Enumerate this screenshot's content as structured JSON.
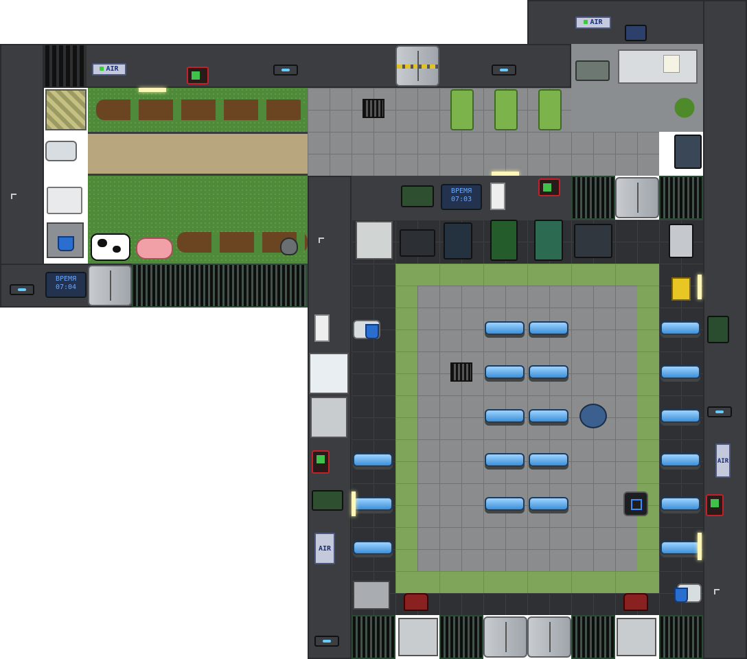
{
  "signs": {
    "air_1": "AIR",
    "air_2": "AIR",
    "air_3": "AIR",
    "air_4": "AIR"
  },
  "clocks": {
    "clock_1_label": "ВРЕМЯ",
    "clock_1_time": "07:04",
    "clock_2_label": "ВРЕМЯ",
    "clock_2_time": "07:03"
  },
  "colors": {
    "wall": "#3c3d40",
    "floor": "#8a8c8d",
    "grass": "#4e8a3a",
    "carpet_green": "#7fa55a",
    "table_glass": "#6cb8f0",
    "alarm_red": "#c4202a"
  }
}
